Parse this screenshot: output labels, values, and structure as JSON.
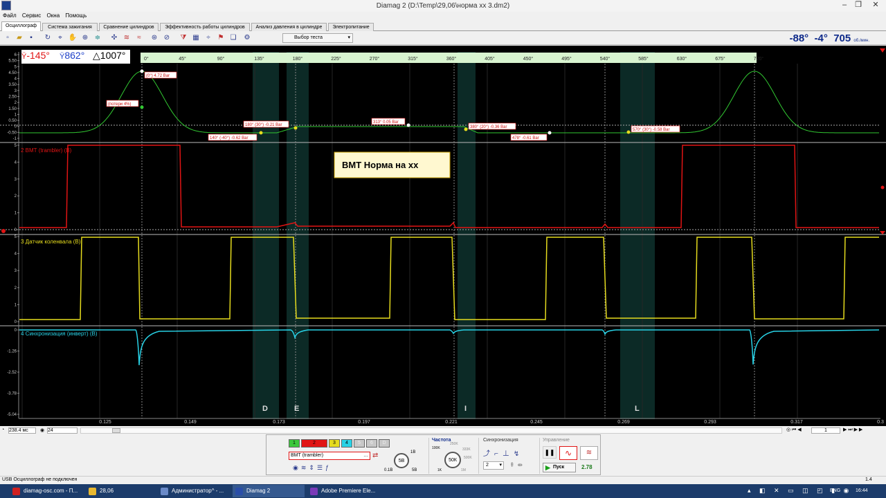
{
  "window": {
    "title": "Diamag 2 (D:\\Temp\\29,06\\норма хх 3.dm2)"
  },
  "menu": [
    "Файл",
    "Сервис",
    "Окна",
    "Помощь"
  ],
  "tabs": [
    "Осциллограф",
    "Система зажигания",
    "Сравнение цилиндров",
    "Эффективность работы цилиндров",
    "Анализ давления в цилиндре",
    "Электропитание"
  ],
  "toolbar": {
    "test_select": "Выбор теста"
  },
  "engine": {
    "angle1": "-88°",
    "angle2": "-4°",
    "rpm": "705",
    "rpm_unit": "об./мин."
  },
  "cursors": {
    "red": "-145°",
    "blue": "862°",
    "delta": "1007°"
  },
  "angle_scale": [
    "0°",
    "45°",
    "90°",
    "135°",
    "180°",
    "225°",
    "270°",
    "315°",
    "360°",
    "405°",
    "450°",
    "495°",
    "540°",
    "585°",
    "630°",
    "675°",
    "720°"
  ],
  "channels": {
    "ch1": {
      "yticks": [
        "6",
        "5.50",
        "5",
        "4.50",
        "4",
        "3.50",
        "3",
        "2.50",
        "2",
        "1.50",
        "1",
        "0.50",
        "0",
        "-0.50",
        "-1"
      ]
    },
    "ch2": {
      "label": "2 ВМТ (trambler) (В)",
      "yticks": [
        "5",
        "4",
        "3",
        "2",
        "1",
        "0"
      ]
    },
    "ch3": {
      "label": "3 Датчик коленвала (В)",
      "yticks": [
        "5",
        "4",
        "3",
        "2",
        "1",
        "0"
      ]
    },
    "ch4": {
      "label": "4 Синхронизация (инверт) (В)",
      "yticks": [
        "0",
        "-1.26",
        "-2.52",
        "-3.78",
        "-5.04"
      ]
    }
  },
  "annotations": {
    "a1": "(0°) 4.72 Bar",
    "a2": "(потери 4%)",
    "a3": "180° (30°) -0.21 Bar",
    "a4": "140° (-40°) -0.62 Bar",
    "a5": "313° 0.05 Bar",
    "a6": "380° (20°) -0.36 Bar",
    "a7": "478° -0.61 Bar",
    "a8": "570° (30°) -0.58 Bar"
  },
  "note": "ВМТ Норма на хх",
  "region_letters": [
    "D",
    "E",
    "I",
    "L"
  ],
  "time_ticks": [
    "0.125",
    "0.149",
    "0.173",
    "0.197",
    "0.221",
    "0.245",
    "0.269",
    "0.293",
    "0.317",
    "0.3"
  ],
  "scrollbar": {
    "timebase": "238.4 мс",
    "divisions": "24",
    "frame": "1",
    "zoom": "1.4"
  },
  "controls": {
    "channel_buttons": [
      "1",
      "2",
      "3",
      "4",
      "5",
      "6",
      "D"
    ],
    "channel_name": "ВМТ (trambler)",
    "volts": {
      "value": "5В",
      "min": "0.1В",
      "max": "1В",
      "max2": "5В"
    },
    "freq_title": "Частота",
    "freq": {
      "value": "50К",
      "t1": "100K",
      "t2": "250K",
      "t3": "333K",
      "t4": "500K",
      "t5": "1K",
      "t6": "1M"
    },
    "sync_title": "Синхронизация",
    "sync_value": "2",
    "control_title": "Управление",
    "start_label": "Пуск",
    "time_value": "2.78"
  },
  "status": "USB Осциллограф не подключен",
  "taskbar": {
    "items": [
      "diamag-osc.com - П...",
      "28,06",
      "Администратор^ - ...",
      "Diamag 2",
      "Adobe Premiere Ele..."
    ],
    "lang": "ENG",
    "time": "16:44"
  },
  "colors": {
    "ch1": "#32c832",
    "ch2": "#e11414",
    "ch3": "#e6dc1e",
    "ch4": "#28d2e6",
    "grid": "#3a3a3a",
    "accent": "#0e2a8a"
  }
}
